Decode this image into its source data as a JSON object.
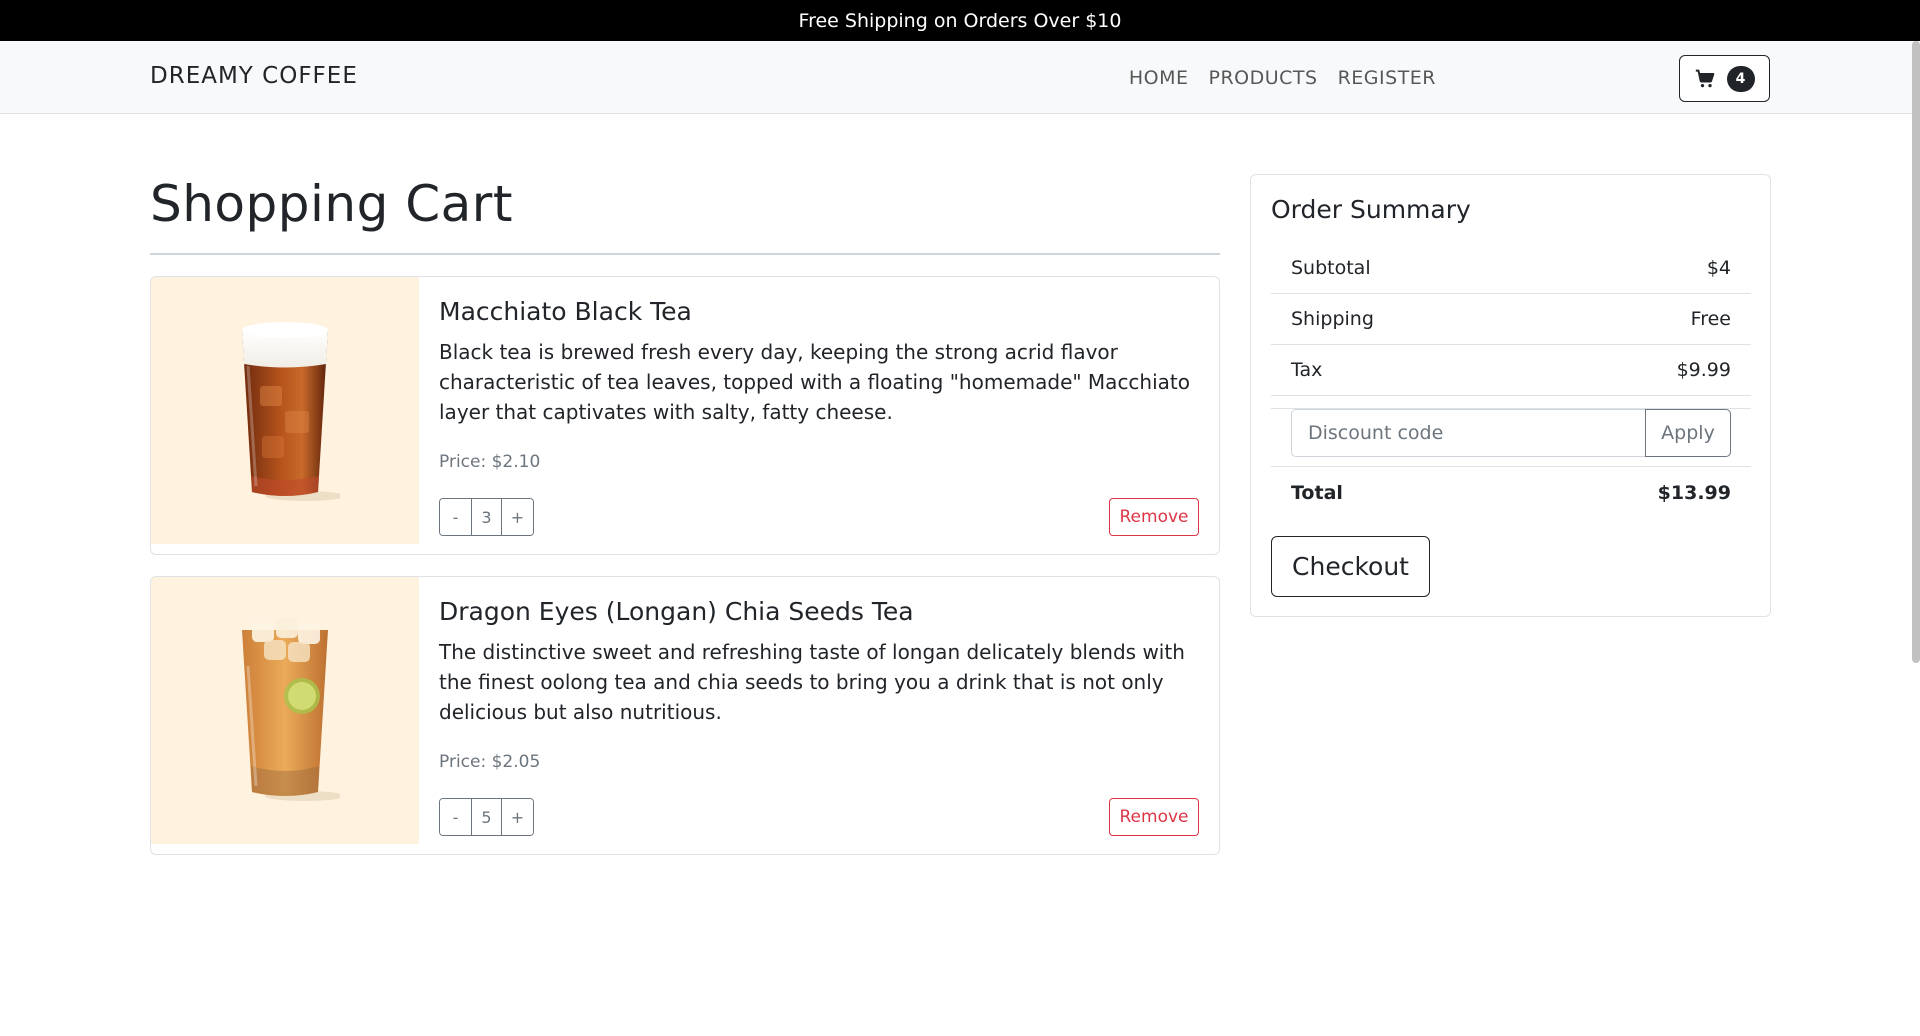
{
  "announcement": "Free Shipping on Orders Over $10",
  "navbar": {
    "brand": "DREAMY COFFEE",
    "links": [
      "HOME",
      "PRODUCTS",
      "REGISTER"
    ],
    "cart_count": "4"
  },
  "page_title": "Shopping Cart",
  "cart_items": [
    {
      "name": "Macchiato Black Tea",
      "description": "Black tea is brewed fresh every day, keeping the strong acrid flavor characteristic of tea leaves, topped with a floating \"homemade\" Macchiato layer that captivates with salty, fatty cheese.",
      "price": "Price: $2.10",
      "quantity": "3",
      "minus_label": "-",
      "plus_label": "+",
      "remove_label": "Remove"
    },
    {
      "name": "Dragon Eyes (Longan) Chia Seeds Tea",
      "description": "The distinctive sweet and refreshing taste of longan delicately blends with the finest oolong tea and chia seeds to bring you a drink that is not only delicious but also nutritious.",
      "price": "Price: $2.05",
      "quantity": "5",
      "minus_label": "-",
      "plus_label": "+",
      "remove_label": "Remove"
    }
  ],
  "summary": {
    "title": "Order Summary",
    "subtotal_label": "Subtotal",
    "subtotal_value": "$4",
    "shipping_label": "Shipping",
    "shipping_value": "Free",
    "tax_label": "Tax",
    "tax_value": "$9.99",
    "discount_placeholder": "Discount code",
    "apply_label": "Apply",
    "total_label": "Total",
    "total_value": "$13.99",
    "checkout_label": "Checkout"
  },
  "icons": {
    "cart": "cart-icon"
  },
  "colors": {
    "announcement_bg": "#000000",
    "danger": "#dc3545",
    "item_image_bg": "#fff3df"
  }
}
